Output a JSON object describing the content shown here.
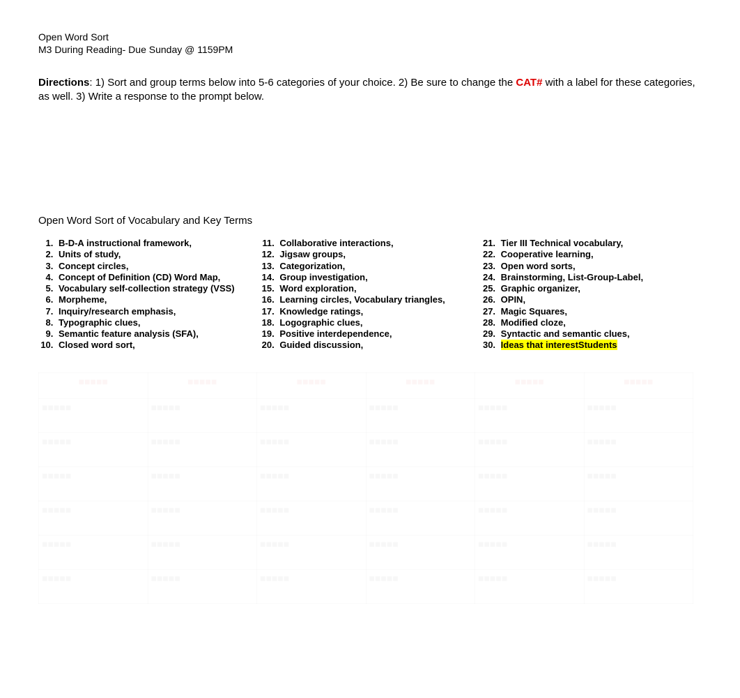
{
  "header": {
    "line1": "Open Word Sort",
    "line2": "M3 During Reading- Due Sunday @ 1159PM"
  },
  "directions": {
    "label": "Directions",
    "text_before_cat": ": 1) Sort and group terms below into 5-6 categories of your choice. 2) Be sure to change the ",
    "cat_label": "CAT#",
    "text_after_cat": " with a label for these categories, as well. 3) Write a response to the prompt below."
  },
  "subtitle": "Open Word Sort of Vocabulary and Key Terms",
  "terms": {
    "col1": [
      "B-D-A instructional framework,",
      "Units of study,",
      "Concept circles,",
      "Concept of Definition (CD) Word Map,",
      "Vocabulary self-collection strategy (VSS)",
      "Morpheme,",
      "Inquiry/research emphasis,",
      "Typographic clues,",
      "Semantic feature analysis (SFA),",
      "Closed word sort,"
    ],
    "col2": [
      "Collaborative interactions,",
      "Jigsaw groups,",
      "Categorization,",
      "Group investigation,",
      "Word exploration,",
      "Learning circles, Vocabulary triangles,",
      "Knowledge ratings,",
      "Logographic clues,",
      "Positive interdependence,",
      "Guided discussion,"
    ],
    "col3": [
      {
        "text": "Tier III Technical vocabulary,",
        "highlight": false
      },
      {
        "text": "Cooperative learning,",
        "highlight": false
      },
      {
        "text": "Open word sorts,",
        "highlight": false
      },
      {
        "text": "Brainstorming, List-Group-Label,",
        "highlight": false
      },
      {
        "text": "Graphic organizer,",
        "highlight": false
      },
      {
        "text": "OPIN,",
        "highlight": false
      },
      {
        "text": "Magic Squares,",
        "highlight": false
      },
      {
        "text": "Modified cloze,",
        "highlight": false
      },
      {
        "text": "Syntactic and semantic clues,",
        "highlight": false
      },
      {
        "text": "Ideas that interestStudents",
        "highlight": true
      }
    ]
  },
  "table": {
    "headers": [
      "",
      "",
      "",
      "",
      "",
      ""
    ],
    "rows": 6,
    "cols": 6
  }
}
